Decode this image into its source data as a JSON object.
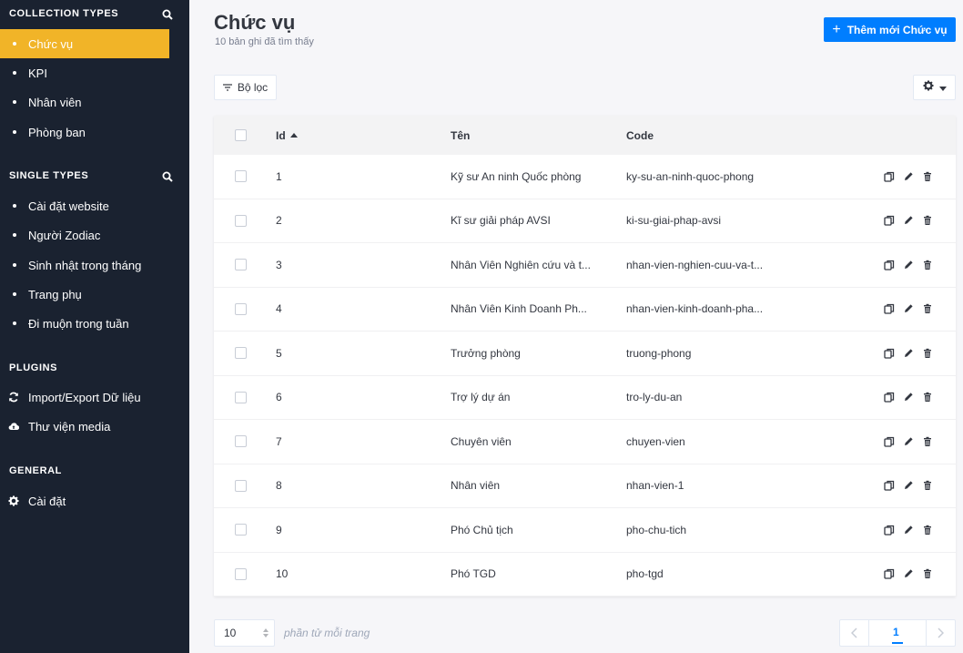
{
  "sidebar": {
    "collection_types": {
      "title": "COLLECTION TYPES",
      "items": [
        {
          "label": "Chức vụ"
        },
        {
          "label": "KPI"
        },
        {
          "label": "Nhân viên"
        },
        {
          "label": "Phòng ban"
        }
      ],
      "active_index": 0
    },
    "single_types": {
      "title": "SINGLE TYPES",
      "items": [
        {
          "label": "Cài đặt website"
        },
        {
          "label": "Người Zodiac"
        },
        {
          "label": "Sinh nhật trong tháng"
        },
        {
          "label": "Trang phụ"
        },
        {
          "label": "Đi muộn trong tuần"
        }
      ]
    },
    "plugins": {
      "title": "PLUGINS",
      "items": [
        {
          "label": "Import/Export Dữ liệu",
          "icon": "sync-icon"
        },
        {
          "label": "Thư viện media",
          "icon": "cloud-upload-icon"
        }
      ]
    },
    "general": {
      "title": "GENERAL",
      "items": [
        {
          "label": "Cài đặt",
          "icon": "gear-icon"
        }
      ]
    }
  },
  "header": {
    "title": "Chức vụ",
    "subtitle": "10 bản ghi đã tìm thấy",
    "add_button": "Thêm mới Chức vụ"
  },
  "toolbar": {
    "filter_label": "Bộ lọc"
  },
  "table": {
    "columns": {
      "id": "Id",
      "name": "Tên",
      "code": "Code"
    },
    "rows": [
      {
        "id": "1",
        "name": "Kỹ sư An ninh Quốc phòng",
        "code": "ky-su-an-ninh-quoc-phong"
      },
      {
        "id": "2",
        "name": "Kĩ sư giải pháp AVSI",
        "code": "ki-su-giai-phap-avsi"
      },
      {
        "id": "3",
        "name": "Nhân Viên Nghiên cứu và t...",
        "code": "nhan-vien-nghien-cuu-va-t..."
      },
      {
        "id": "4",
        "name": "Nhân Viên Kinh Doanh Ph...",
        "code": "nhan-vien-kinh-doanh-pha..."
      },
      {
        "id": "5",
        "name": "Trưởng phòng",
        "code": "truong-phong"
      },
      {
        "id": "6",
        "name": "Trợ lý dự án",
        "code": "tro-ly-du-an"
      },
      {
        "id": "7",
        "name": "Chuyên viên",
        "code": "chuyen-vien"
      },
      {
        "id": "8",
        "name": "Nhân viên",
        "code": "nhan-vien-1"
      },
      {
        "id": "9",
        "name": "Phó Chủ tịch",
        "code": "pho-chu-tich"
      },
      {
        "id": "10",
        "name": "Phó TGD",
        "code": "pho-tgd"
      }
    ]
  },
  "footer": {
    "per_page_value": "10",
    "per_page_label": "phần tử mỗi trang",
    "current_page": "1"
  },
  "colors": {
    "sidebar_bg": "#1a2230",
    "active_item": "#f1b428",
    "primary": "#007eff"
  }
}
